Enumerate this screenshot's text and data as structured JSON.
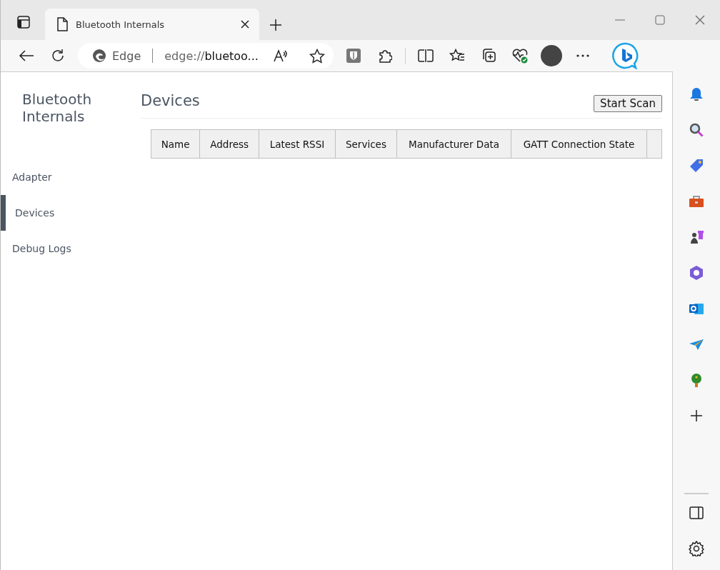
{
  "browser": {
    "tab": {
      "title": "Bluetooth Internals"
    },
    "address_bar": {
      "site_label": "Edge",
      "url_scheme": "edge://",
      "url_rest": "bluetoo..."
    }
  },
  "page": {
    "app_title": "Bluetooth Internals",
    "heading": "Devices",
    "scan_button": "Start Scan",
    "nav": [
      {
        "label": "Adapter",
        "selected": false
      },
      {
        "label": "Devices",
        "selected": true
      },
      {
        "label": "Debug Logs",
        "selected": false
      }
    ],
    "table": {
      "columns": [
        "Name",
        "Address",
        "Latest RSSI",
        "Services",
        "Manufacturer Data",
        "GATT Connection State"
      ]
    }
  }
}
